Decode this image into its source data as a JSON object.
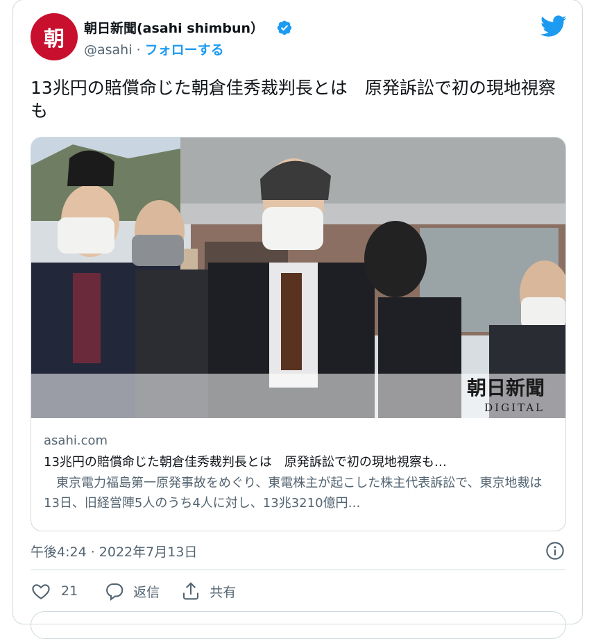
{
  "author": {
    "name": "朝日新聞(asahi shimbun）",
    "avatar_char": "朝",
    "handle": "@asahi",
    "separator": "·",
    "follow_label": "フォローする"
  },
  "tweet": {
    "text": "13兆円の賠償命じた朝倉佳秀裁判長とは　原発訴訟で初の現地視察も"
  },
  "link_card": {
    "watermark_title": "朝日新聞",
    "watermark_sub": "DIGITAL",
    "domain": "asahi.com",
    "title": "13兆円の賠償命じた朝倉佳秀裁判長とは　原発訴訟で初の現地視察も…",
    "description": "　東京電力福島第一原発事故をめぐり、東電株主が起こした株主代表訴訟で、東京地裁は13日、旧経営陣5人のうち4人に対し、13兆3210億円…"
  },
  "timestamp": "午後4:24 · 2022年7月13日",
  "actions": {
    "like_count": "21",
    "reply_label": "返信",
    "share_label": "共有"
  },
  "colors": {
    "accent": "#1d9bf0",
    "brand_red": "#c8102e",
    "muted": "#536471",
    "border": "#cfd9de"
  }
}
